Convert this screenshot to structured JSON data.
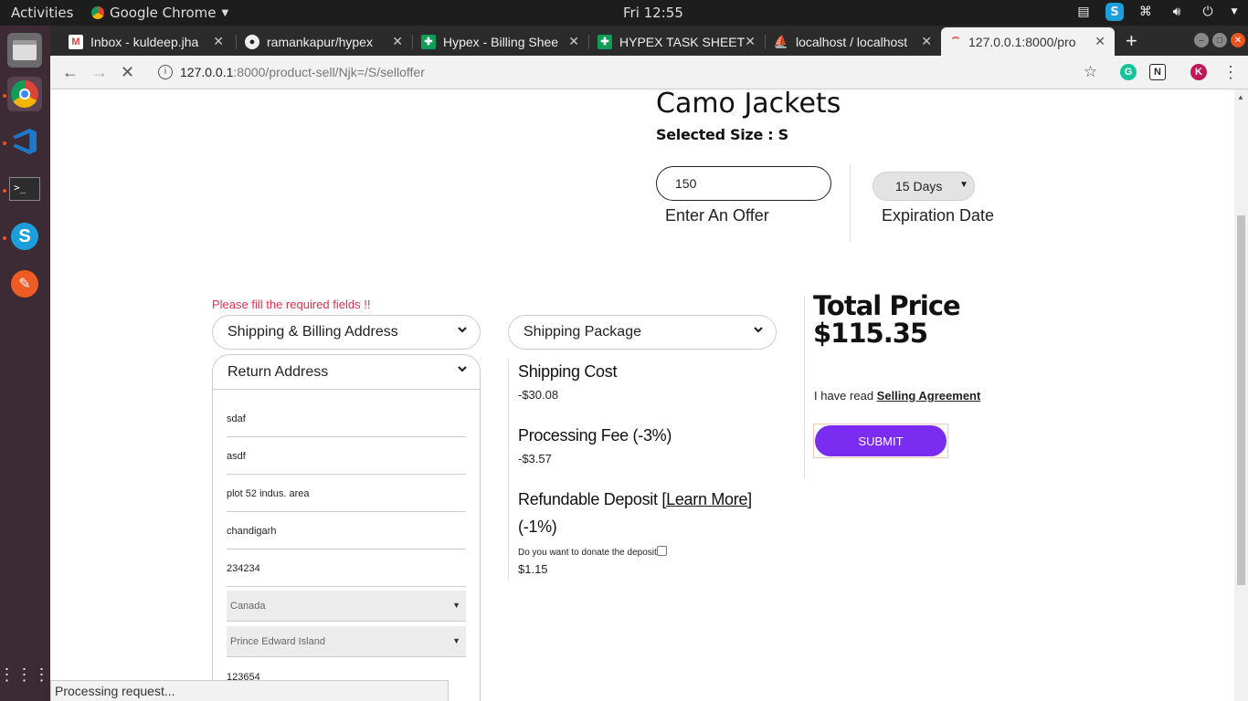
{
  "system": {
    "activities": "Activities",
    "app_name": "Google Chrome",
    "clock": "Fri 12:55"
  },
  "tabs": [
    {
      "title": "Inbox - kuldeep.jha",
      "icon": "gmail-icon"
    },
    {
      "title": "ramankapur/hypex",
      "icon": "github-icon"
    },
    {
      "title": "Hypex - Billing Shee",
      "icon": "sheets-icon"
    },
    {
      "title": "HYPEX TASK SHEET",
      "icon": "sheets-icon"
    },
    {
      "title": "localhost / localhost",
      "icon": "phpmyadmin-icon"
    },
    {
      "title": "127.0.0.1:8000/pro",
      "icon": "loading-icon"
    }
  ],
  "address_bar": {
    "host": "127.0.0.1",
    "path": ":8000/product-sell/Njk=/S/selloffer"
  },
  "product": {
    "title": "Camo Jackets",
    "selected_size": "Selected Size : S"
  },
  "offer": {
    "value": "150",
    "label": "Enter An Offer",
    "expiration_value": "15 Days",
    "expiration_label": "Expiration Date"
  },
  "form": {
    "error": "Please fill the required fields !!",
    "shipping_billing": "Shipping & Billing Address",
    "return_address": "Return Address",
    "fields": [
      "sdaf",
      "asdf",
      "plot 52 indus. area",
      "chandigarh",
      "234234"
    ],
    "country": "Canada",
    "province": "Prince Edward Island",
    "phone": "123654"
  },
  "costs": {
    "shipping_package": "Shipping Package",
    "shipping_cost_label": "Shipping Cost",
    "shipping_cost_value": "-$30.08",
    "processing_fee_label": "Processing Fee (-3%)",
    "processing_fee_value": "-$3.57",
    "deposit_label": "Refundable Deposit",
    "deposit_link": "[Learn More]",
    "deposit_pct": "(-1%)",
    "donate_text": "Do you want to donate the deposit",
    "deposit_value": "$1.15"
  },
  "summary": {
    "total_label": "Total Price",
    "total_value": "$115.35",
    "agreement_prefix": "I have read",
    "agreement_link": "Selling Agreement",
    "submit": "SUBMIT"
  },
  "status_bar": "Processing request...",
  "colors": {
    "accent": "#7a2cf0",
    "error": "#e0314b"
  }
}
